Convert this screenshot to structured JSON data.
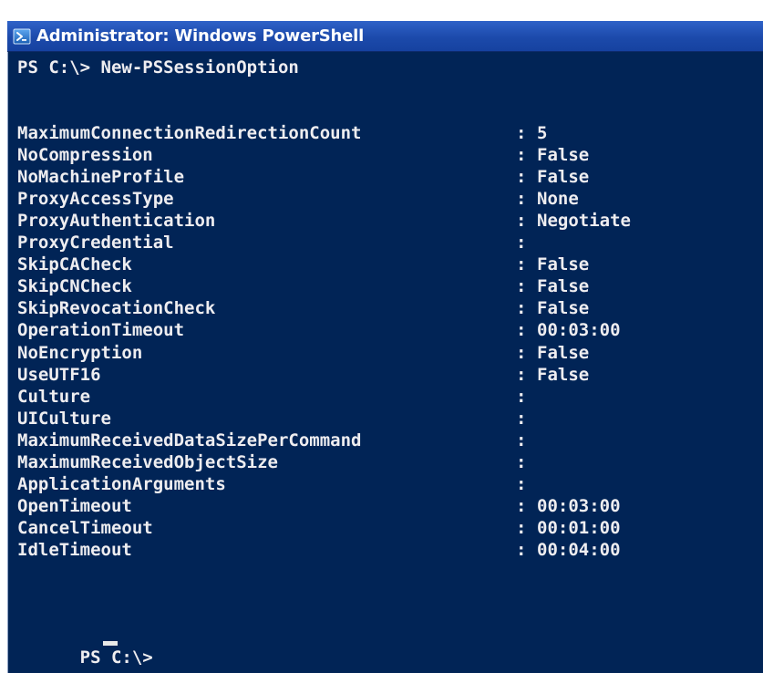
{
  "window": {
    "title": "Administrator: Windows PowerShell",
    "icon": "powershell-icon"
  },
  "console": {
    "background": "#012456",
    "foreground": "#eeedf0",
    "command_line": "PS C:\\> New-PSSessionOption",
    "properties": [
      {
        "name": "MaximumConnectionRedirectionCount",
        "value": "5"
      },
      {
        "name": "NoCompression",
        "value": "False"
      },
      {
        "name": "NoMachineProfile",
        "value": "False"
      },
      {
        "name": "ProxyAccessType",
        "value": "None"
      },
      {
        "name": "ProxyAuthentication",
        "value": "Negotiate"
      },
      {
        "name": "ProxyCredential",
        "value": ""
      },
      {
        "name": "SkipCACheck",
        "value": "False"
      },
      {
        "name": "SkipCNCheck",
        "value": "False"
      },
      {
        "name": "SkipRevocationCheck",
        "value": "False"
      },
      {
        "name": "OperationTimeout",
        "value": "00:03:00"
      },
      {
        "name": "NoEncryption",
        "value": "False"
      },
      {
        "name": "UseUTF16",
        "value": "False"
      },
      {
        "name": "Culture",
        "value": ""
      },
      {
        "name": "UICulture",
        "value": ""
      },
      {
        "name": "MaximumReceivedDataSizePerCommand",
        "value": ""
      },
      {
        "name": "MaximumReceivedObjectSize",
        "value": ""
      },
      {
        "name": "ApplicationArguments",
        "value": ""
      },
      {
        "name": "OpenTimeout",
        "value": "00:03:00"
      },
      {
        "name": "CancelTimeout",
        "value": "00:01:00"
      },
      {
        "name": "IdleTimeout",
        "value": "00:04:00"
      }
    ],
    "separator": ":",
    "prompt": "PS C:\\> "
  }
}
